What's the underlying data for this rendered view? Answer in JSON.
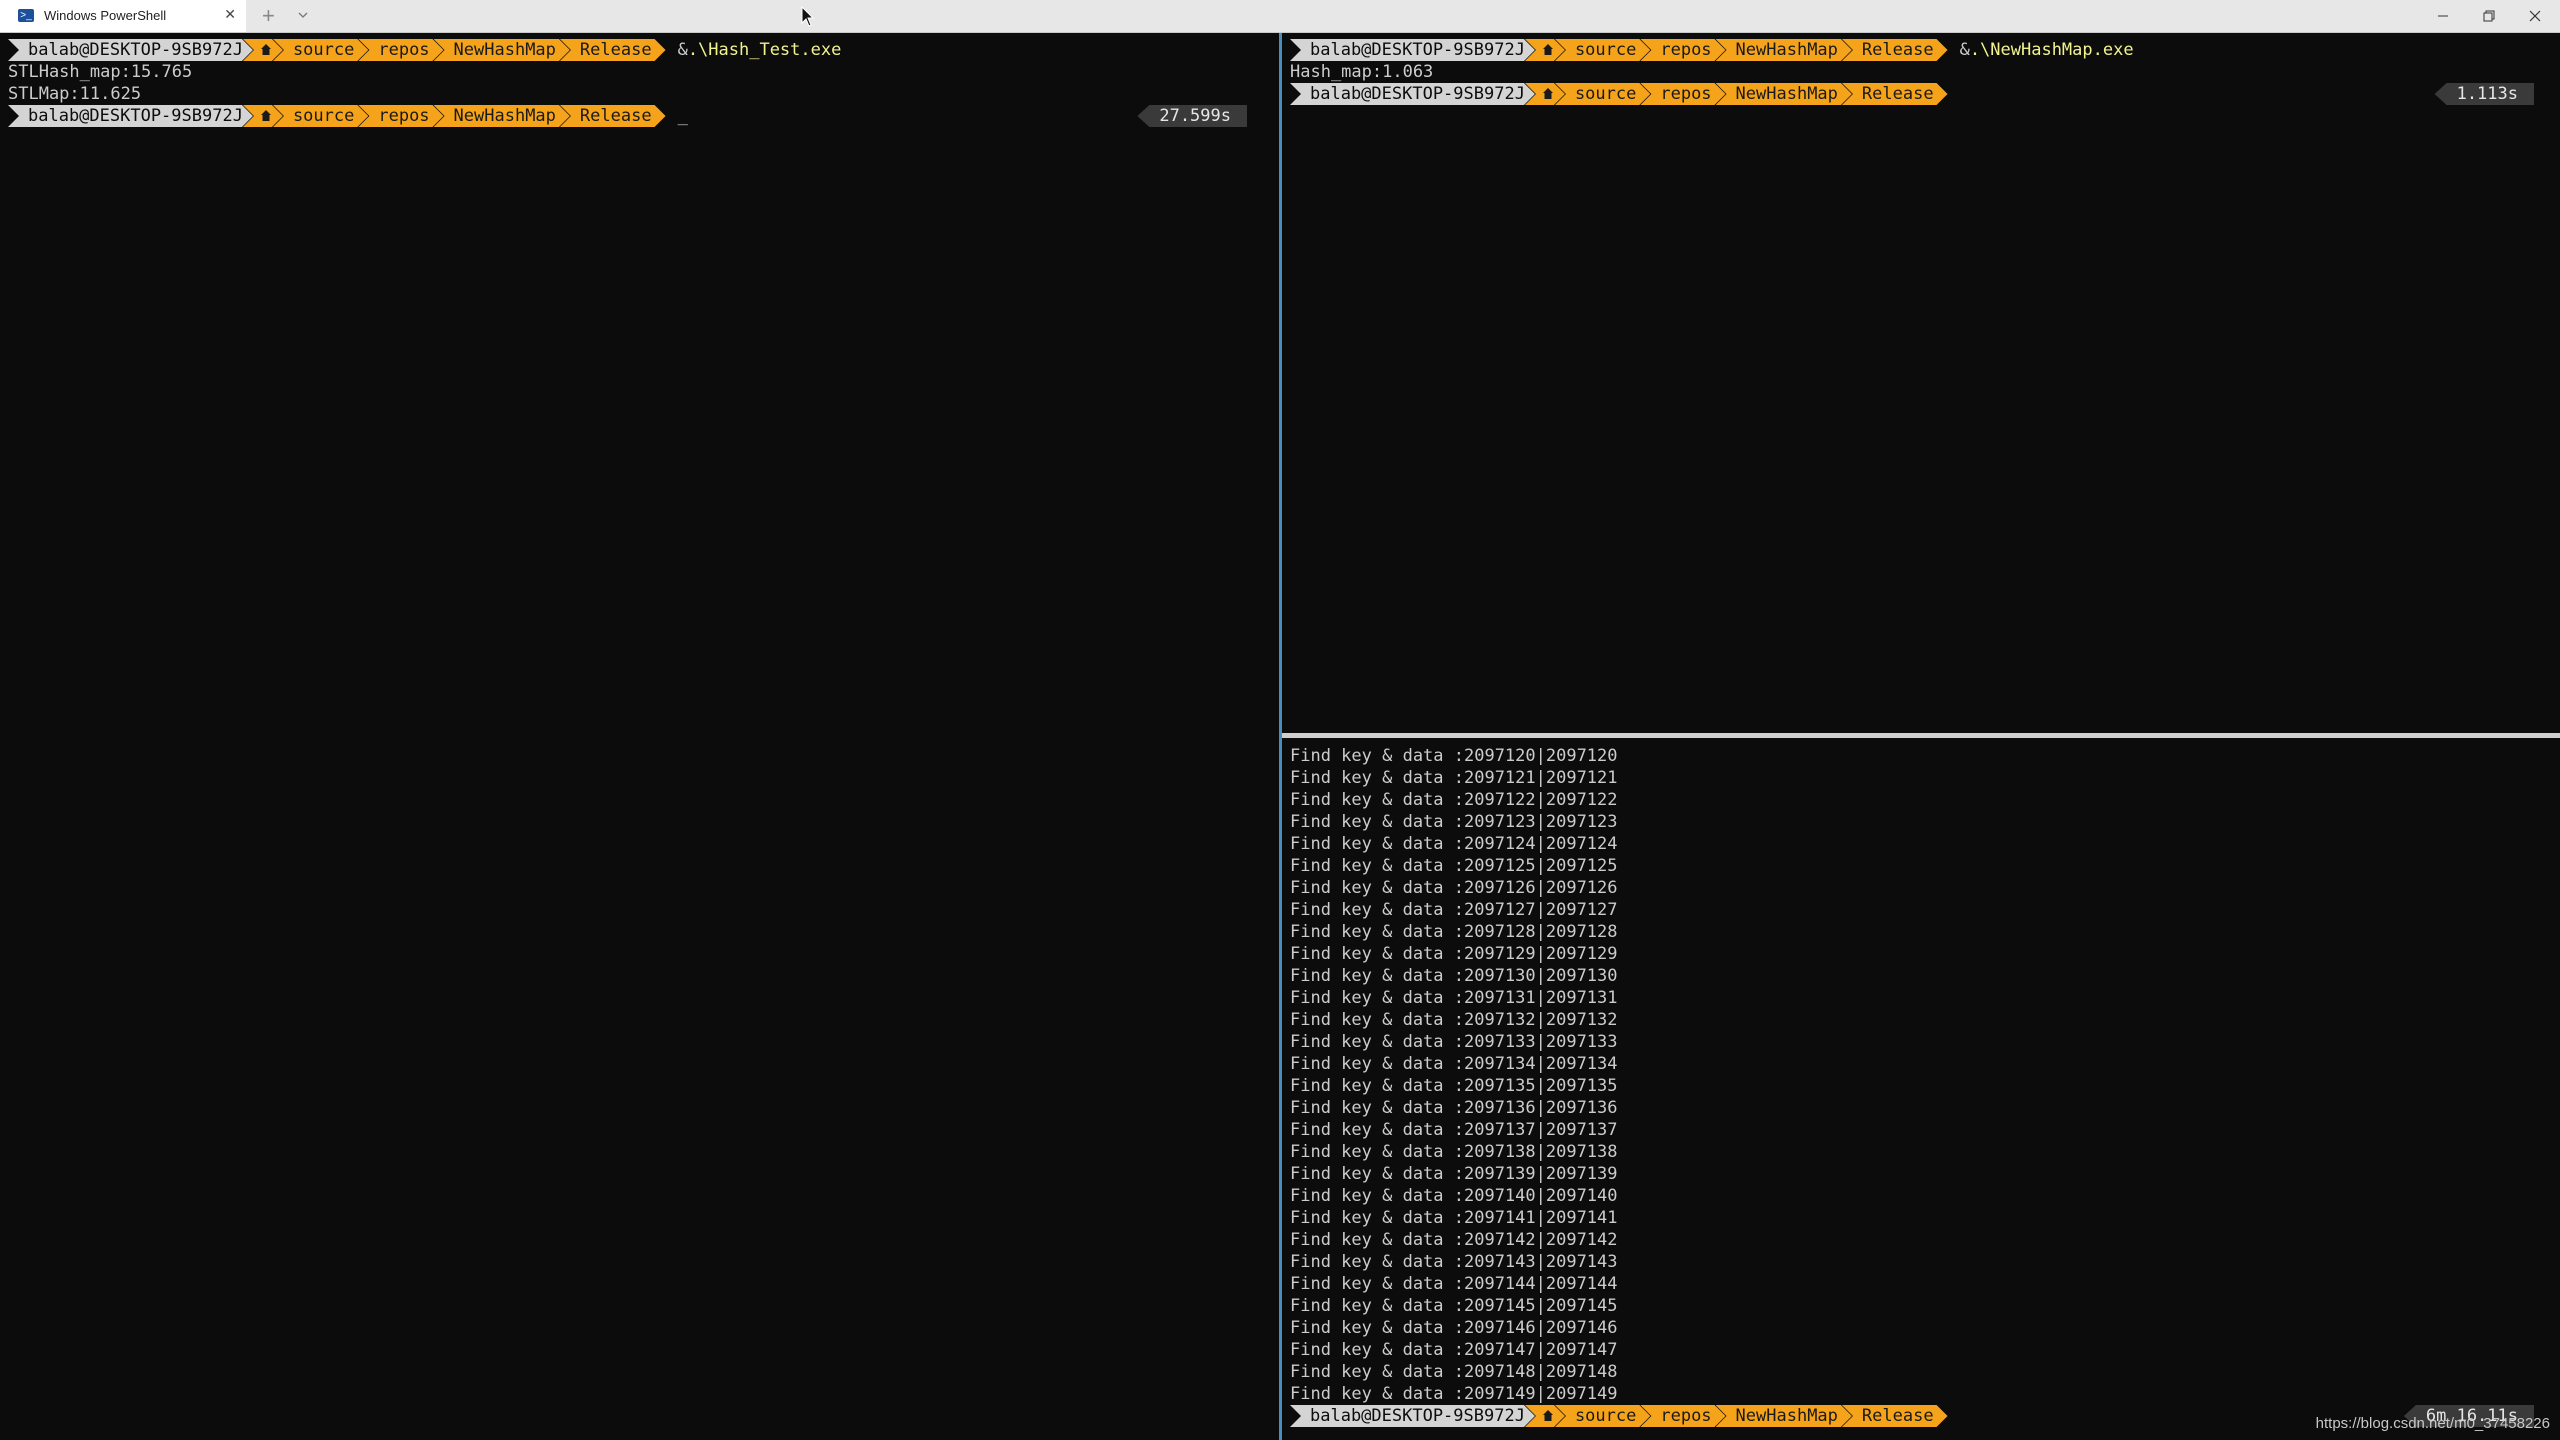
{
  "window": {
    "tab_title": "Windows PowerShell",
    "tab_icon_glyph": ">_",
    "new_tab_glyph": "+",
    "close_tab_glyph": "✕"
  },
  "prompt": {
    "user": "balab@DESKTOP-9SB972J",
    "path": [
      "source",
      "repos",
      "NewHashMap",
      "Release"
    ]
  },
  "left_pane": {
    "command_amp": "&",
    "command": ".\\Hash_Test.exe",
    "output": [
      "STLHash_map:15.765",
      "STLMap:11.625"
    ],
    "cursor": "_",
    "duration": "27.599s"
  },
  "right_top_pane": {
    "command_amp": "&",
    "command": ".\\NewHashMap.exe",
    "output": [
      "Hash_map:1.063"
    ],
    "duration": "1.113s"
  },
  "right_bottom_pane": {
    "output": [
      "Find key & data :2097120|2097120",
      "Find key & data :2097121|2097121",
      "Find key & data :2097122|2097122",
      "Find key & data :2097123|2097123",
      "Find key & data :2097124|2097124",
      "Find key & data :2097125|2097125",
      "Find key & data :2097126|2097126",
      "Find key & data :2097127|2097127",
      "Find key & data :2097128|2097128",
      "Find key & data :2097129|2097129",
      "Find key & data :2097130|2097130",
      "Find key & data :2097131|2097131",
      "Find key & data :2097132|2097132",
      "Find key & data :2097133|2097133",
      "Find key & data :2097134|2097134",
      "Find key & data :2097135|2097135",
      "Find key & data :2097136|2097136",
      "Find key & data :2097137|2097137",
      "Find key & data :2097138|2097138",
      "Find key & data :2097139|2097139",
      "Find key & data :2097140|2097140",
      "Find key & data :2097141|2097141",
      "Find key & data :2097142|2097142",
      "Find key & data :2097143|2097143",
      "Find key & data :2097144|2097144",
      "Find key & data :2097145|2097145",
      "Find key & data :2097146|2097146",
      "Find key & data :2097147|2097147",
      "Find key & data :2097148|2097148",
      "Find key & data :2097149|2097149"
    ],
    "duration": "6m 16.11s"
  },
  "watermark": "https://blog.csdn.net/m0_37458226",
  "colors": {
    "terminal_bg": "#0c0c0c",
    "segment_orange": "#f5a31a",
    "segment_user": "#d4d4d4",
    "command_yellow": "#f2f28e",
    "split_accent": "#4a8dbf"
  }
}
